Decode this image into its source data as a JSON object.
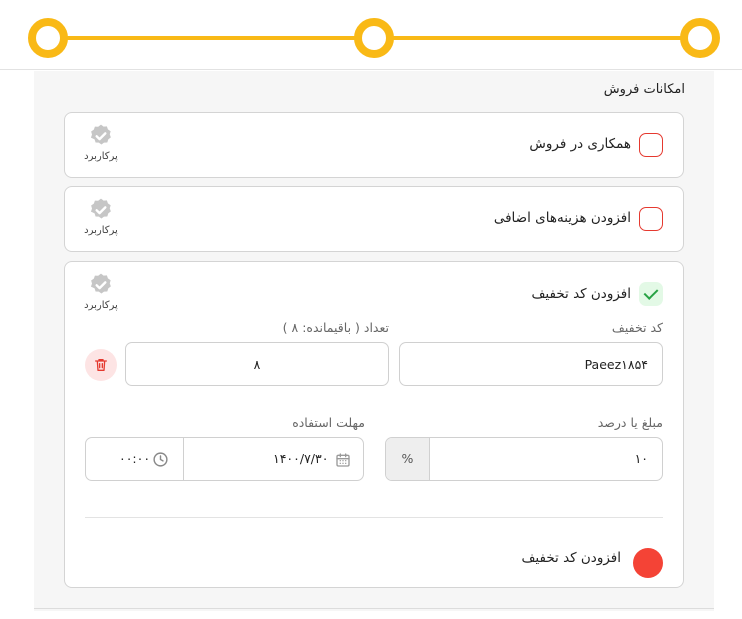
{
  "section_title": "امکانات فروش",
  "badge_text": "پرکاربرد",
  "options": [
    {
      "label": "همکاری در فروش",
      "checked": false
    },
    {
      "label": "افزودن هزینه‌های اضافی",
      "checked": false
    },
    {
      "label": "افزودن کد تخفیف",
      "checked": true
    }
  ],
  "discount": {
    "code_label": "کد تخفیف",
    "code_value": "Paeez۱۸۵۴",
    "count_label": "تعداد ( باقیمانده: ۸ )",
    "count_value": "۸",
    "amount_label": "مبلغ یا درصد",
    "amount_value": "۱۰",
    "percent_symbol": "%",
    "deadline_label": "مهلت استفاده",
    "date_value": "۱۴۰۰/۷/۳۰",
    "time_value": "۰۰:۰۰"
  },
  "add_discount_label": "افزودن کد تخفیف",
  "colors": {
    "accent": "#f9b916",
    "danger": "#f44336",
    "success": "#27a244"
  },
  "icons": [
    "verified-badge-icon",
    "trash-icon",
    "calendar-icon",
    "clock-icon",
    "check-icon"
  ]
}
